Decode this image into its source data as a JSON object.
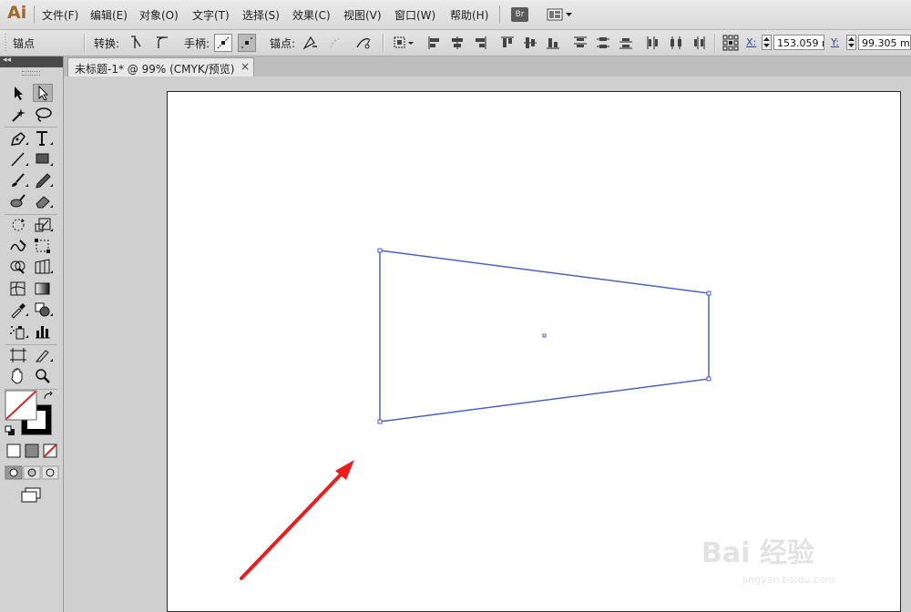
{
  "app": {
    "logo": "Ai"
  },
  "menu": {
    "items": [
      "文件(F)",
      "编辑(E)",
      "对象(O)",
      "文字(T)",
      "选择(S)",
      "效果(C)",
      "视图(V)",
      "窗口(W)",
      "帮助(H)"
    ],
    "bridge_label": "Br"
  },
  "controlbar": {
    "anchor_label": "锚点",
    "convert_label": "转换:",
    "handles_label": "手柄:",
    "anchors_label": "锚点:",
    "x_label": "X:",
    "x_value": "153.059 ı",
    "y_label": "Y:",
    "y_value": "99.305 mi"
  },
  "document": {
    "tab_title": "未标题-1* @ 99% (CMYK/预览)",
    "close_glyph": "×"
  },
  "tools": [
    "selection-tool",
    "direct-selection-tool",
    "magic-wand-tool",
    "lasso-tool",
    "pen-tool",
    "type-tool",
    "line-segment-tool",
    "rectangle-tool",
    "paintbrush-tool",
    "pencil-tool",
    "blob-brush-tool",
    "eraser-tool",
    "rotate-tool",
    "scale-tool",
    "warp-tool",
    "free-transform-tool",
    "shape-builder-tool",
    "perspective-grid-tool",
    "mesh-tool",
    "gradient-tool",
    "eyedropper-tool",
    "blend-tool",
    "symbol-sprayer-tool",
    "column-graph-tool",
    "artboard-tool",
    "slice-tool",
    "hand-tool",
    "zoom-tool"
  ],
  "colors": {
    "path_stroke": "#4a62c8",
    "annotation_arrow": "#ee1c1c",
    "stroke_swatch": "#000000",
    "none_slash": "#e32222"
  },
  "watermark": {
    "text": "Bai 经验",
    "sub": "jingyan.baidu.com"
  }
}
